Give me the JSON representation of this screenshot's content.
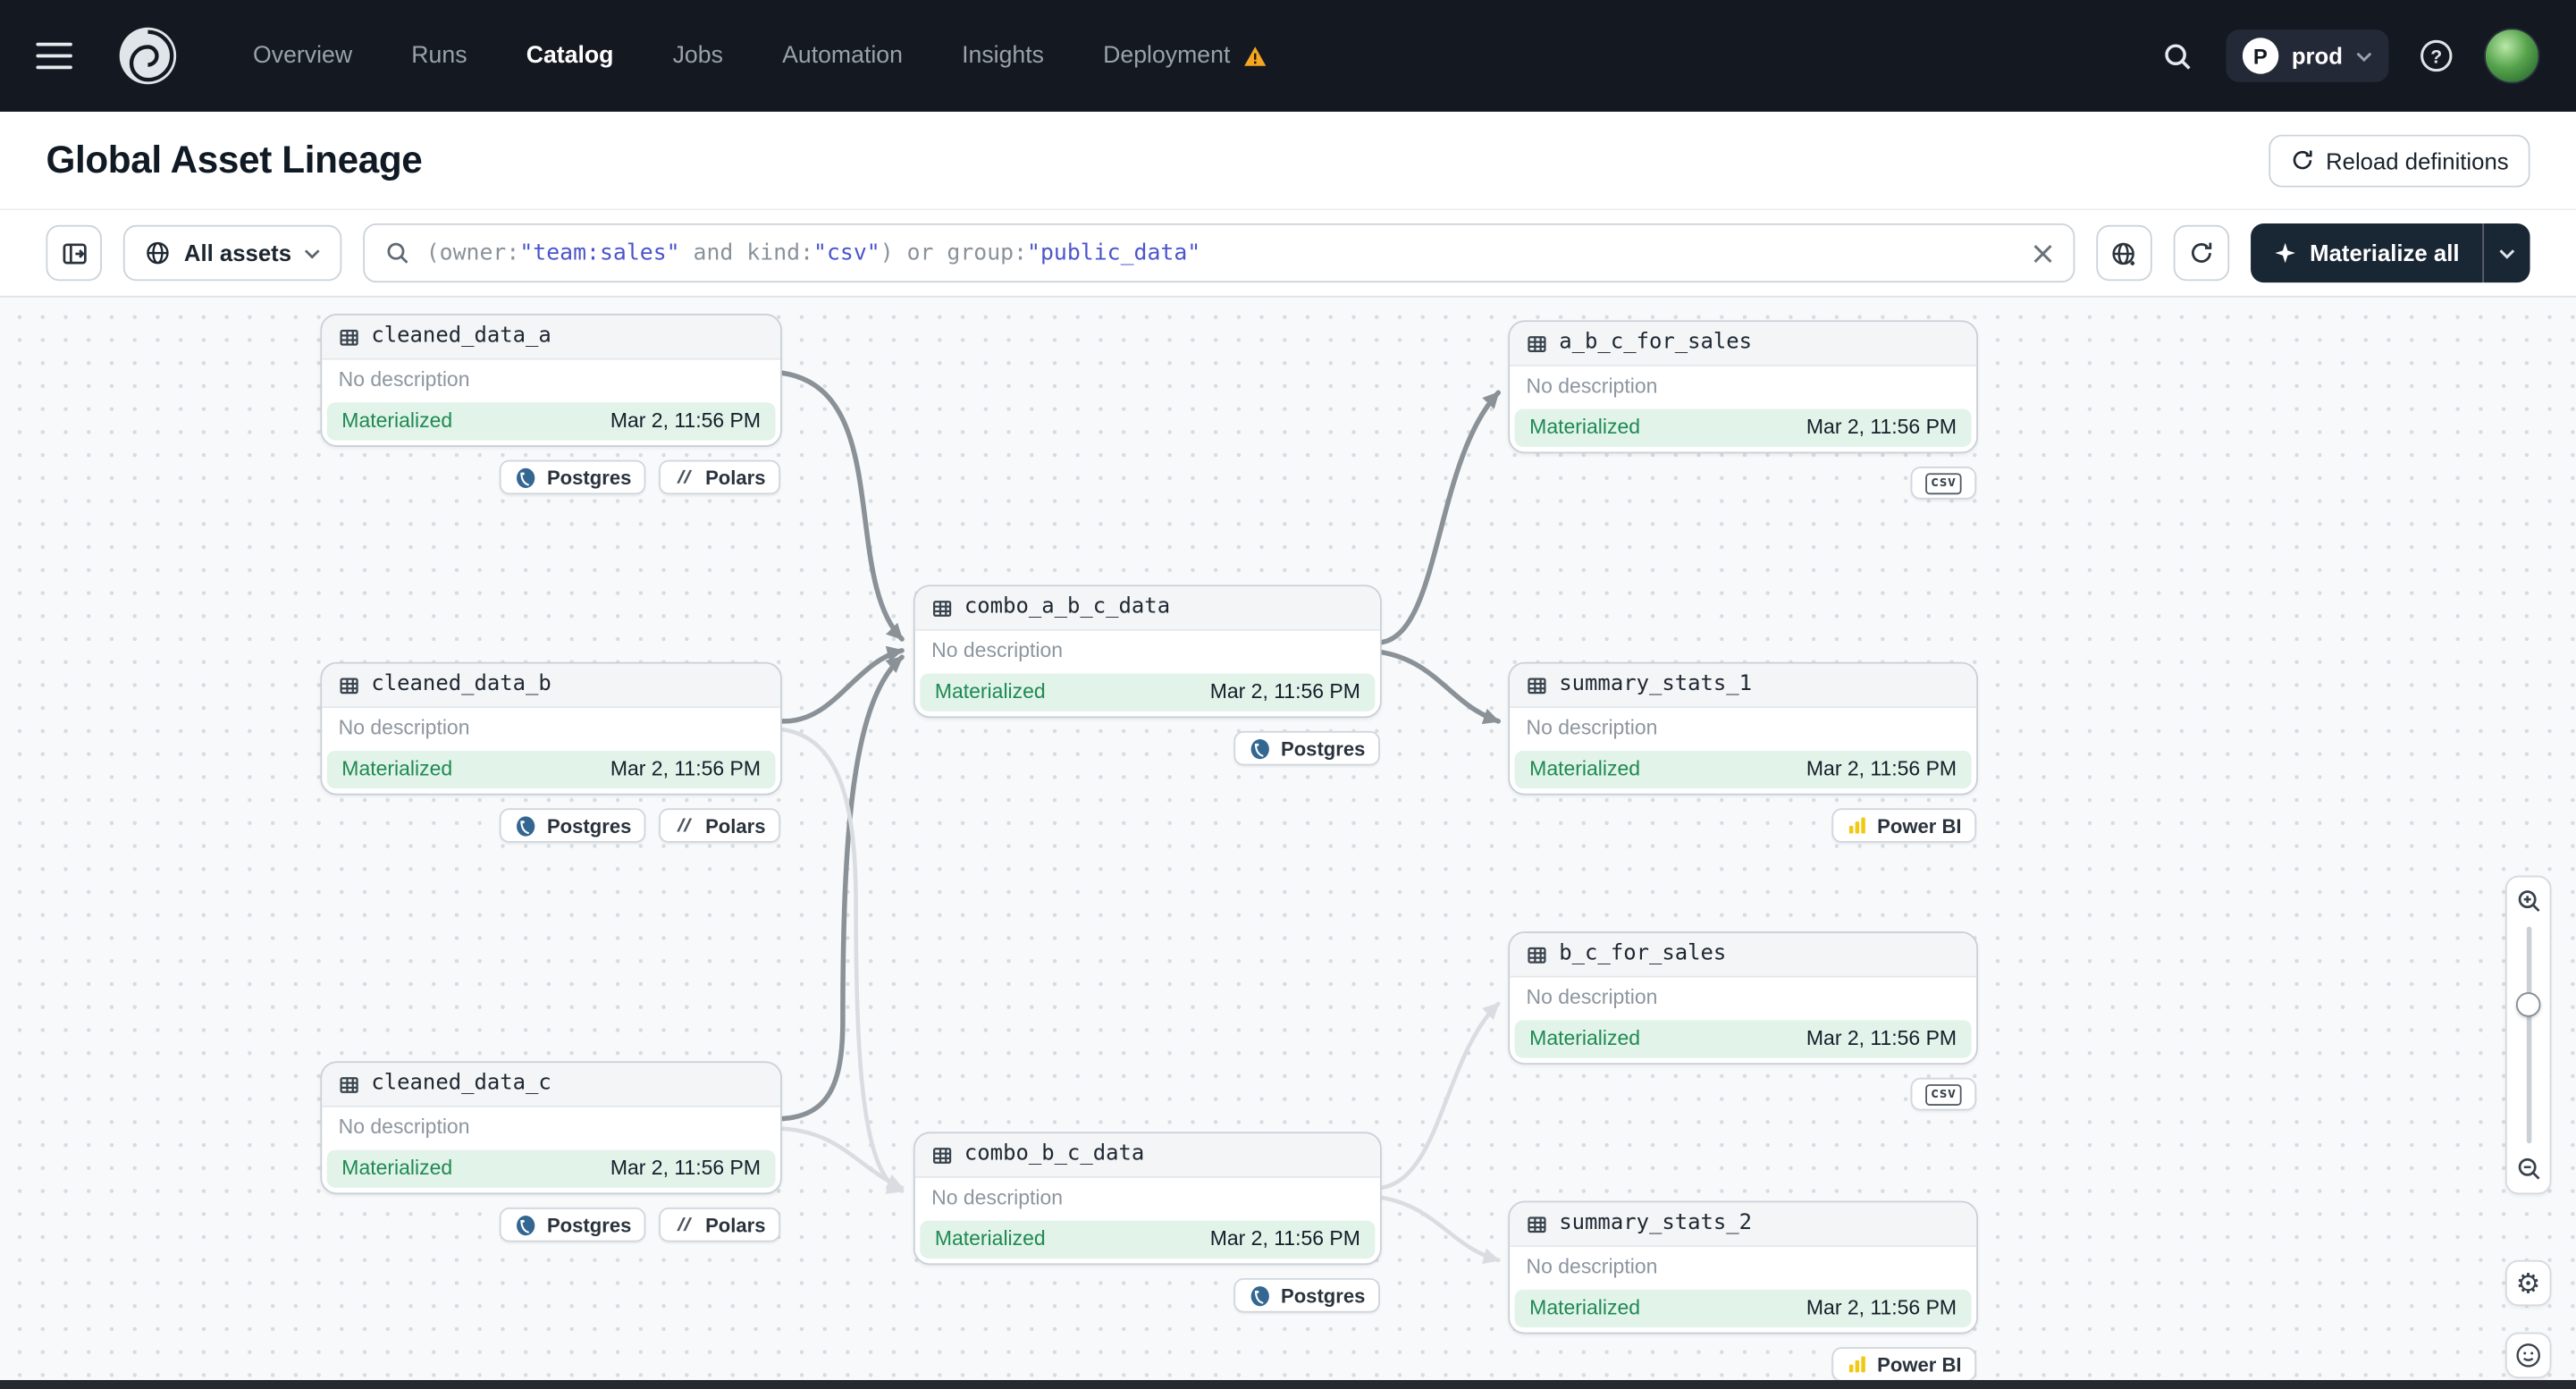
{
  "nav": {
    "items": [
      "Overview",
      "Runs",
      "Catalog",
      "Jobs",
      "Automation",
      "Insights",
      "Deployment"
    ],
    "active_item": "Catalog",
    "warning_item": "Deployment",
    "env": {
      "initial": "P",
      "name": "prod"
    }
  },
  "header": {
    "title": "Global Asset Lineage",
    "reload_button": "Reload definitions"
  },
  "toolbar": {
    "scope_label": "All assets",
    "materialize_label": "Materialize all",
    "query_tokens": [
      {
        "text": "(owner:",
        "kind": "plain"
      },
      {
        "text": "\"team:sales\"",
        "kind": "string"
      },
      {
        "text": " and kind:",
        "kind": "plain"
      },
      {
        "text": "\"csv\"",
        "kind": "string"
      },
      {
        "text": ") or group:",
        "kind": "plain"
      },
      {
        "text": "\"public_data\"",
        "kind": "string"
      }
    ]
  },
  "graph": {
    "nodes": [
      {
        "id": "cleaned_data_a",
        "name": "cleaned_data_a",
        "description": "No description",
        "status": "Materialized",
        "timestamp": "Mar 2, 11:56 PM",
        "tags": [
          {
            "kind": "postgres",
            "label": "Postgres"
          },
          {
            "kind": "polars",
            "label": "Polars"
          }
        ]
      },
      {
        "id": "cleaned_data_b",
        "name": "cleaned_data_b",
        "description": "No description",
        "status": "Materialized",
        "timestamp": "Mar 2, 11:56 PM",
        "tags": [
          {
            "kind": "postgres",
            "label": "Postgres"
          },
          {
            "kind": "polars",
            "label": "Polars"
          }
        ]
      },
      {
        "id": "cleaned_data_c",
        "name": "cleaned_data_c",
        "description": "No description",
        "status": "Materialized",
        "timestamp": "Mar 2, 11:56 PM",
        "tags": [
          {
            "kind": "postgres",
            "label": "Postgres"
          },
          {
            "kind": "polars",
            "label": "Polars"
          }
        ]
      },
      {
        "id": "combo_a_b_c_data",
        "name": "combo_a_b_c_data",
        "description": "No description",
        "status": "Materialized",
        "timestamp": "Mar 2, 11:56 PM",
        "tags": [
          {
            "kind": "postgres",
            "label": "Postgres"
          }
        ]
      },
      {
        "id": "combo_b_c_data",
        "name": "combo_b_c_data",
        "description": "No description",
        "status": "Materialized",
        "timestamp": "Mar 2, 11:56 PM",
        "tags": [
          {
            "kind": "postgres",
            "label": "Postgres"
          }
        ]
      },
      {
        "id": "a_b_c_for_sales",
        "name": "a_b_c_for_sales",
        "description": "No description",
        "status": "Materialized",
        "timestamp": "Mar 2, 11:56 PM",
        "tags": [
          {
            "kind": "csv",
            "label": "csv"
          }
        ]
      },
      {
        "id": "summary_stats_1",
        "name": "summary_stats_1",
        "description": "No description",
        "status": "Materialized",
        "timestamp": "Mar 2, 11:56 PM",
        "tags": [
          {
            "kind": "powerbi",
            "label": "Power BI"
          }
        ]
      },
      {
        "id": "b_c_for_sales",
        "name": "b_c_for_sales",
        "description": "No description",
        "status": "Materialized",
        "timestamp": "Mar 2, 11:56 PM",
        "tags": [
          {
            "kind": "csv",
            "label": "csv"
          }
        ]
      },
      {
        "id": "summary_stats_2",
        "name": "summary_stats_2",
        "description": "No description",
        "status": "Materialized",
        "timestamp": "Mar 2, 11:56 PM",
        "tags": [
          {
            "kind": "powerbi",
            "label": "Power BI"
          }
        ]
      }
    ],
    "edges": [
      {
        "from": "cleaned_data_a",
        "to": "combo_a_b_c_data",
        "emphasis": "strong"
      },
      {
        "from": "cleaned_data_b",
        "to": "combo_a_b_c_data",
        "emphasis": "strong"
      },
      {
        "from": "cleaned_data_c",
        "to": "combo_a_b_c_data",
        "emphasis": "strong"
      },
      {
        "from": "cleaned_data_b",
        "to": "combo_b_c_data",
        "emphasis": "faint"
      },
      {
        "from": "cleaned_data_c",
        "to": "combo_b_c_data",
        "emphasis": "faint"
      },
      {
        "from": "combo_a_b_c_data",
        "to": "a_b_c_for_sales",
        "emphasis": "strong"
      },
      {
        "from": "combo_a_b_c_data",
        "to": "summary_stats_1",
        "emphasis": "strong"
      },
      {
        "from": "combo_b_c_data",
        "to": "b_c_for_sales",
        "emphasis": "faint"
      },
      {
        "from": "combo_b_c_data",
        "to": "summary_stats_2",
        "emphasis": "faint"
      }
    ]
  },
  "colors": {
    "nav_bg": "#141821",
    "materialized_bg": "#e2f3e9",
    "materialized_text": "#1e8a52",
    "warning_orange": "#f5a623",
    "query_string_blue": "#4a55cc",
    "edge_strong": "#8a9197",
    "edge_faint": "#d9dde1",
    "powerbi_yellow": "#f2c811",
    "postgres_blue": "#336791"
  }
}
